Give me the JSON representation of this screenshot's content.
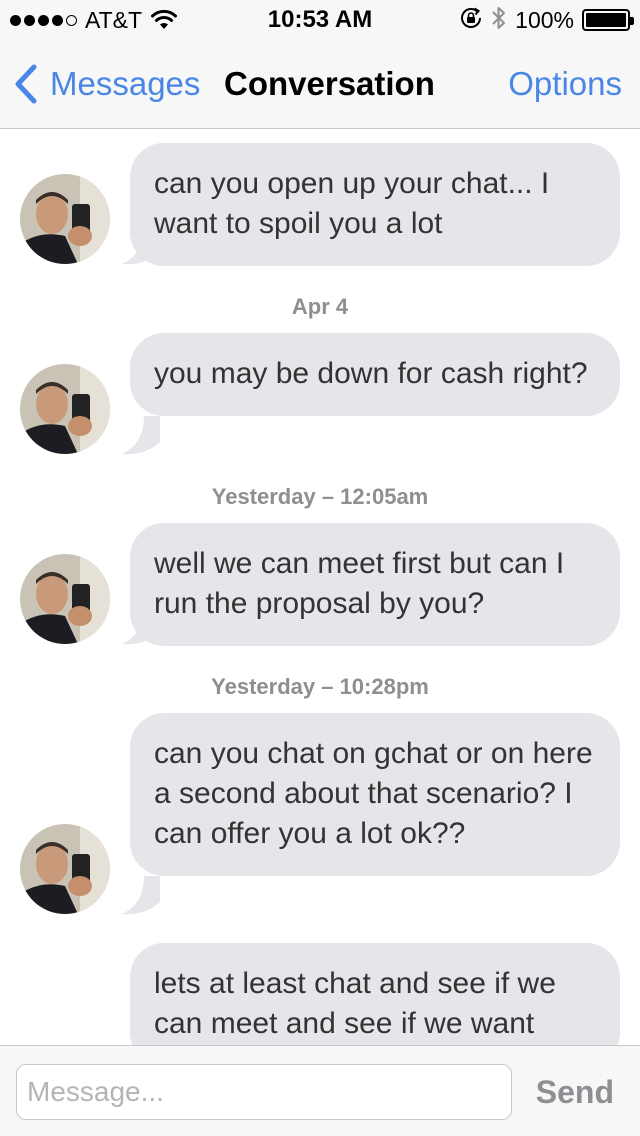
{
  "status_bar": {
    "carrier": "AT&T",
    "time": "10:53 AM",
    "battery_percent": "100%",
    "battery_level": 1.0,
    "signal_bars_filled": 4,
    "signal_bars_total": 5,
    "icons": [
      "signal-icon",
      "wifi-icon",
      "rotation-lock-icon",
      "bluetooth-icon",
      "battery-icon"
    ]
  },
  "nav": {
    "back_label": "Messages",
    "title": "Conversation",
    "options_label": "Options"
  },
  "conversation": {
    "items": [
      {
        "type": "message",
        "text": "can you open up your chat... I want to spoil you a lot",
        "has_avatar": true
      },
      {
        "type": "timestamp",
        "text": "Apr 4"
      },
      {
        "type": "message",
        "text": "you may be down for cash right?",
        "has_avatar": true
      },
      {
        "type": "timestamp",
        "text": "Yesterday – 12:05am"
      },
      {
        "type": "message",
        "text": "well we can meet first but can I run the proposal by you?",
        "has_avatar": true
      },
      {
        "type": "timestamp",
        "text": "Yesterday – 10:28pm"
      },
      {
        "type": "message",
        "text": "can you chat on gchat or on here a second about that scenario? I can offer you a lot ok??",
        "has_avatar": true
      },
      {
        "type": "message",
        "text": "lets at least chat and see if we can meet and see if we want",
        "has_avatar": false
      }
    ]
  },
  "input_bar": {
    "placeholder": "Message...",
    "value": "",
    "send_label": "Send"
  },
  "colors": {
    "accent": "#4a86e8",
    "bubble_incoming": "#e5e5ea",
    "timestamp_text": "#8e8e93",
    "bar_background": "#f7f7f7"
  }
}
